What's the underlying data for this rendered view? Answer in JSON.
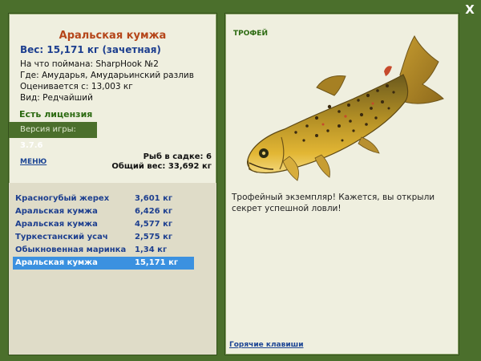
{
  "fish": {
    "name": "Аральская кумжа",
    "weight": "Вес: 15,171 кг (зачетная)",
    "bait": "На что поймана: SharpHook №2",
    "location": "Где: Амударья, Амударьинский разлив",
    "estimate": "Оценивается с: 13,003 кг",
    "kind": "Вид: Редчайший"
  },
  "license": "Есть лицензия",
  "version": {
    "label": "Версия игры:",
    "value": "3.7.6"
  },
  "menu_label": "МЕНЮ",
  "keep": {
    "count": "Рыб в садке: 6",
    "total": "Общий вес: 33,692 кг"
  },
  "catches": [
    {
      "name": "Красногубый жерех",
      "weight": "3,601 кг"
    },
    {
      "name": "Аральская кумжа",
      "weight": "6,426 кг"
    },
    {
      "name": "Аральская кумжа",
      "weight": "4,577 кг"
    },
    {
      "name": "Туркестанский усач",
      "weight": "2,575 кг"
    },
    {
      "name": "Обыкновенная маринка",
      "weight": "1,34 кг"
    },
    {
      "name": "Аральская кумжа",
      "weight": "15,171 кг"
    }
  ],
  "trophy": {
    "label": "ТРОФЕЙ",
    "text": "Трофейный экземпляр! Кажется, вы открыли секрет успешной ловли!"
  },
  "hotkeys": "Горячие клавиши",
  "close_label": "X",
  "icons": {
    "close": "close-icon",
    "fish": "brown-trout-picture"
  },
  "colors": {
    "frame": "#4b6f2c",
    "panel": "#efefdf",
    "title": "#b5461a",
    "link": "#1c4594",
    "selected_row": "#3b91e0"
  }
}
